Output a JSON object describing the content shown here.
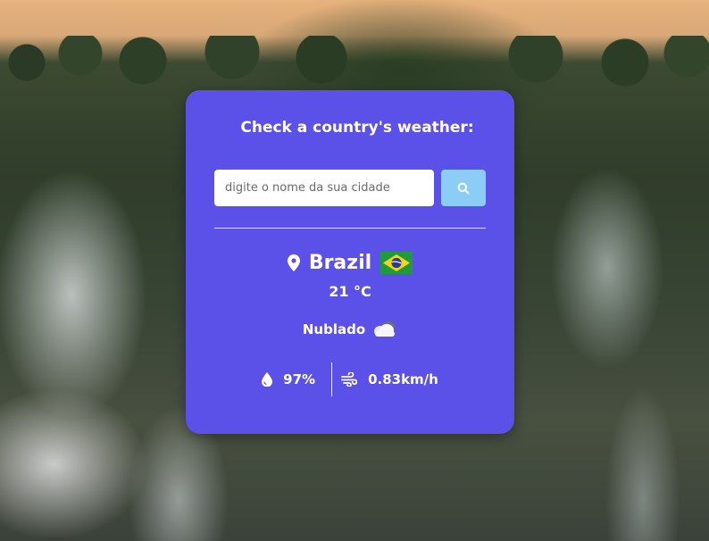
{
  "card": {
    "title": "Check a country's weather:",
    "search": {
      "placeholder": "digite o nome da sua cidade",
      "value": ""
    },
    "location": {
      "name": "Brazil",
      "flag": "Brazil flag"
    },
    "temperature": "21 °C",
    "condition": {
      "text": "Nublado",
      "icon": "cloud-icon"
    },
    "humidity": {
      "value": "97%",
      "icon": "water-drop-icon"
    },
    "wind": {
      "value": "0.83km/h",
      "icon": "wind-icon"
    }
  },
  "colors": {
    "card_background": "#5b51e9",
    "search_button": "#8ccdf7",
    "text": "#ffffff"
  }
}
